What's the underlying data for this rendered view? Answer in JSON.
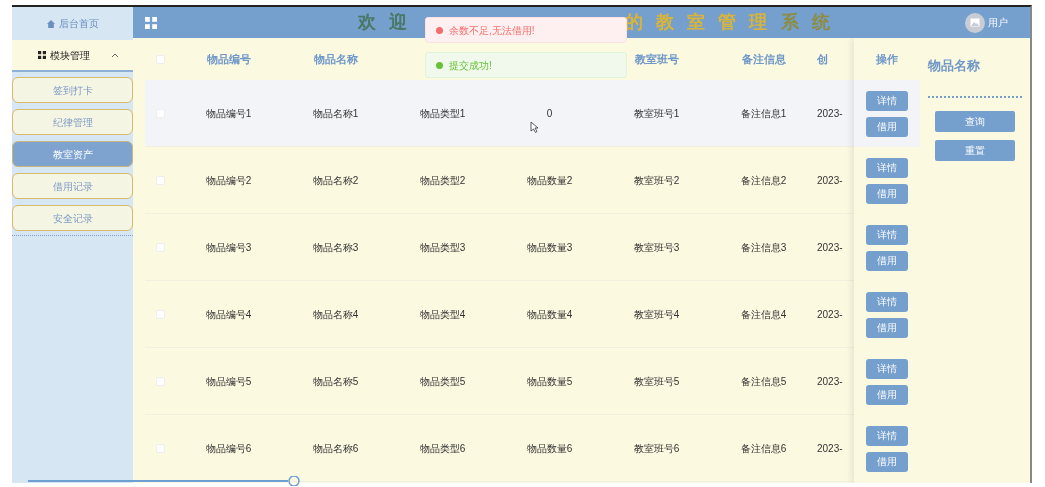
{
  "sidebar": {
    "home": "后台首页",
    "group": {
      "label": "模块管理",
      "expanded": true
    },
    "items": [
      {
        "label": "签到打卡",
        "selected": false
      },
      {
        "label": "纪律管理",
        "selected": false
      },
      {
        "label": "教室资产",
        "selected": true
      },
      {
        "label": "借用记录",
        "selected": false
      },
      {
        "label": "安全记录",
        "selected": false
      }
    ]
  },
  "header": {
    "title_parts": [
      {
        "text": "欢 迎",
        "color": "#4a7866"
      },
      {
        "text": "的 教 室 管 理",
        "color": "#d8b53a"
      },
      {
        "text": "系 统",
        "color": "#8c8d44"
      }
    ],
    "user": "用户"
  },
  "toasts": [
    {
      "kind": "error",
      "text": "余数不足,无法借用!"
    },
    {
      "kind": "success",
      "text": "提交成功!"
    }
  ],
  "table": {
    "columns": [
      "物品编号",
      "物品名称",
      "",
      "",
      "教室班号",
      "备注信息",
      "创"
    ],
    "select_all_checked": false,
    "actions_header": "操作",
    "rows": [
      {
        "cells": [
          "物品编号1",
          "物品名称1",
          "物品类型1",
          "0",
          "教室班号1",
          "备注信息1",
          "2023-"
        ],
        "hovered": true,
        "checked": false,
        "actions": [
          "详情",
          "借用"
        ]
      },
      {
        "cells": [
          "物品编号2",
          "物品名称2",
          "物品类型2",
          "物品数量2",
          "教室班号2",
          "备注信息2",
          "2023-"
        ],
        "hovered": false,
        "checked": false,
        "actions": [
          "详情",
          "借用"
        ]
      },
      {
        "cells": [
          "物品编号3",
          "物品名称3",
          "物品类型3",
          "物品数量3",
          "教室班号3",
          "备注信息3",
          "2023-"
        ],
        "hovered": false,
        "checked": false,
        "actions": [
          "详情",
          "借用"
        ]
      },
      {
        "cells": [
          "物品编号4",
          "物品名称4",
          "物品类型4",
          "物品数量4",
          "教室班号4",
          "备注信息4",
          "2023-"
        ],
        "hovered": false,
        "checked": false,
        "actions": [
          "详情",
          "借用"
        ]
      },
      {
        "cells": [
          "物品编号5",
          "物品名称5",
          "物品类型5",
          "物品数量5",
          "教室班号5",
          "备注信息5",
          "2023-"
        ],
        "hovered": false,
        "checked": false,
        "actions": [
          "详情",
          "借用"
        ]
      },
      {
        "cells": [
          "物品编号6",
          "物品名称6",
          "物品类型6",
          "物品数量6",
          "教室班号6",
          "备注信息6",
          "2023-"
        ],
        "hovered": false,
        "checked": false,
        "actions": [
          "详情",
          "借用"
        ]
      }
    ]
  },
  "search_panel": {
    "title": "物品名称",
    "buttons": [
      "查询",
      "重置"
    ]
  }
}
